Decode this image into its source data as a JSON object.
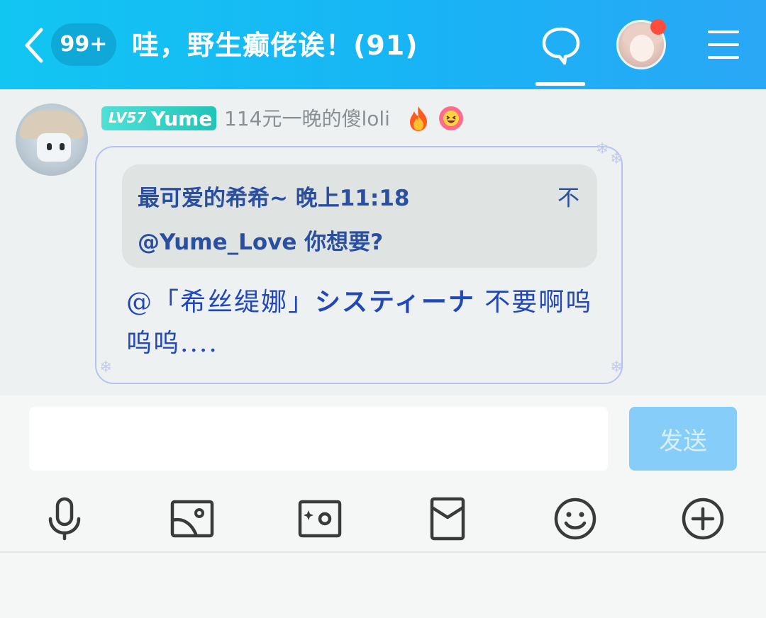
{
  "header": {
    "unread_badge": "99+",
    "title": "哇，野生癫佬诶！(91)"
  },
  "message": {
    "level": "LV57",
    "sender_name": "Yume",
    "sender_title": "114元一晚的傻loli",
    "emojis": [
      "🔥",
      "😆"
    ],
    "quote": {
      "author": "最可爱的希希~",
      "time": "晚上11:18",
      "pin_glyph": "不",
      "text": "@Yume_Love 你想要?"
    },
    "body_mention": "@「希丝缇娜」",
    "body_mention_kana": "システィーナ",
    "body_text": " 不要啊呜呜呜...."
  },
  "composer": {
    "input_value": "",
    "send_label": "发送"
  },
  "toolbar": {
    "icons": [
      "microphone-icon",
      "image-icon",
      "camera-icon",
      "red-envelope-icon",
      "emoji-icon",
      "plus-icon"
    ]
  },
  "colors": {
    "header_gradient_start": "#12c6f2",
    "header_gradient_end": "#2aa7f6",
    "level_tag": "#21c4b8",
    "message_text": "#2147b8",
    "send_button": "#86cdf9",
    "notification_dot": "#ff4d3d"
  }
}
